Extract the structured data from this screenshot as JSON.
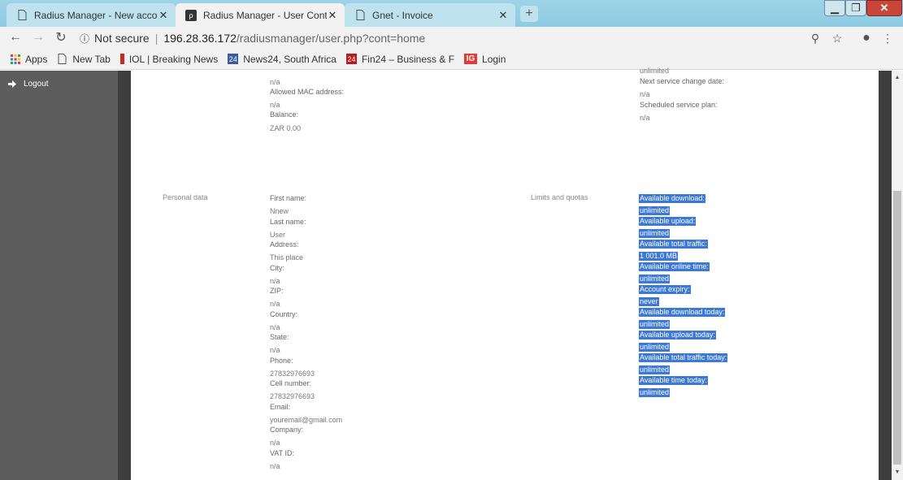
{
  "browser": {
    "tabs": [
      {
        "title": "Radius Manager - New account",
        "active": false
      },
      {
        "title": "Radius Manager - User Control P",
        "active": true
      },
      {
        "title": "Gnet - Invoice",
        "active": false
      }
    ],
    "new_tab_symbol": "+",
    "url_security": "Not secure",
    "url_host": "196.28.36.172",
    "url_path": "/radiusmanager/user.php?cont=home",
    "bookmarks": [
      {
        "label": "Apps",
        "icon": "apps-grid-icon"
      },
      {
        "label": "New Tab",
        "icon": "page-icon"
      },
      {
        "label": "IOL | Breaking News",
        "icon": "iol-icon"
      },
      {
        "label": "News24, South Africa",
        "icon": "news24-icon"
      },
      {
        "label": "Fin24 – Business & F",
        "icon": "fin24-icon"
      },
      {
        "label": "Login",
        "icon": "ig-icon"
      }
    ]
  },
  "sidebar": {
    "logout_label": "Logout"
  },
  "top_left": {
    "val0": "n/a",
    "mac_label": "Allowed MAC address:",
    "mac_value": "n/a",
    "balance_label": "Balance:",
    "balance_value": "ZAR 0.00"
  },
  "top_right": {
    "cut_value": "unlimited",
    "next_change_label": "Next service change date:",
    "next_change_value": "n/a",
    "scheduled_label": "Scheduled service plan:",
    "scheduled_value": "n/a"
  },
  "personal": {
    "section_label": "Personal data",
    "fields": [
      {
        "label": "First name:",
        "value": "Nnew"
      },
      {
        "label": "Last name:",
        "value": "User"
      },
      {
        "label": "Address:",
        "value": "This place"
      },
      {
        "label": "City:",
        "value": "n/a"
      },
      {
        "label": "ZIP:",
        "value": "n/a"
      },
      {
        "label": "Country:",
        "value": "n/a"
      },
      {
        "label": "State:",
        "value": "n/a"
      },
      {
        "label": "Phone:",
        "value": "27832976693"
      },
      {
        "label": "Cell number:",
        "value": "27832976693"
      },
      {
        "label": "Email:",
        "value": "youremail@gmail.com"
      },
      {
        "label": "Company:",
        "value": "n/a"
      },
      {
        "label": "VAT ID:",
        "value": "n/a"
      }
    ]
  },
  "limits": {
    "section_label": "Limits and quotas",
    "fields": [
      {
        "label": "Available download:",
        "value": "unlimited"
      },
      {
        "label": "Available upload:",
        "value": "unlimited"
      },
      {
        "label": "Available total traffic:",
        "value": "1 001.0 MB"
      },
      {
        "label": "Available online time:",
        "value": "unlimited"
      },
      {
        "label": "Account expiry:",
        "value": "never"
      },
      {
        "label": "Available download today:",
        "value": "unlimited"
      },
      {
        "label": "Available upload today:",
        "value": "unlimited"
      },
      {
        "label": "Available total traffic today:",
        "value": "unlimited"
      },
      {
        "label": "Available time today:",
        "value": "unlimited"
      }
    ]
  },
  "colors": {
    "sidebar": "#5d5d5d",
    "selection": "#3c78d8",
    "chrome": "#f2f2f2"
  }
}
